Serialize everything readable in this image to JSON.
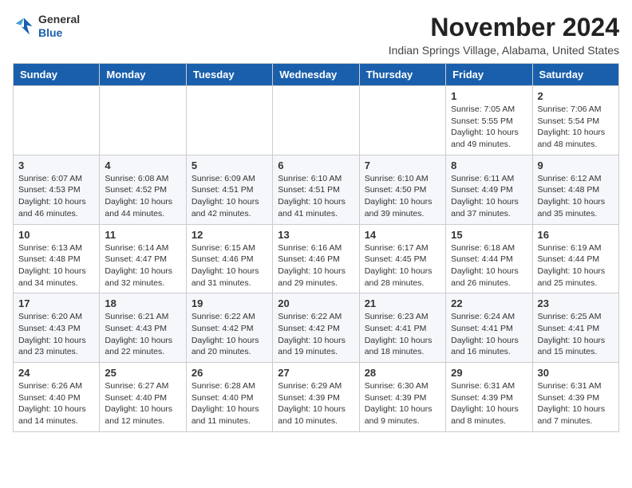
{
  "logo": {
    "line1": "General",
    "line2": "Blue"
  },
  "title": "November 2024",
  "location": "Indian Springs Village, Alabama, United States",
  "days_of_week": [
    "Sunday",
    "Monday",
    "Tuesday",
    "Wednesday",
    "Thursday",
    "Friday",
    "Saturday"
  ],
  "weeks": [
    [
      {
        "day": "",
        "info": ""
      },
      {
        "day": "",
        "info": ""
      },
      {
        "day": "",
        "info": ""
      },
      {
        "day": "",
        "info": ""
      },
      {
        "day": "",
        "info": ""
      },
      {
        "day": "1",
        "info": "Sunrise: 7:05 AM\nSunset: 5:55 PM\nDaylight: 10 hours and 49 minutes."
      },
      {
        "day": "2",
        "info": "Sunrise: 7:06 AM\nSunset: 5:54 PM\nDaylight: 10 hours and 48 minutes."
      }
    ],
    [
      {
        "day": "3",
        "info": "Sunrise: 6:07 AM\nSunset: 4:53 PM\nDaylight: 10 hours and 46 minutes."
      },
      {
        "day": "4",
        "info": "Sunrise: 6:08 AM\nSunset: 4:52 PM\nDaylight: 10 hours and 44 minutes."
      },
      {
        "day": "5",
        "info": "Sunrise: 6:09 AM\nSunset: 4:51 PM\nDaylight: 10 hours and 42 minutes."
      },
      {
        "day": "6",
        "info": "Sunrise: 6:10 AM\nSunset: 4:51 PM\nDaylight: 10 hours and 41 minutes."
      },
      {
        "day": "7",
        "info": "Sunrise: 6:10 AM\nSunset: 4:50 PM\nDaylight: 10 hours and 39 minutes."
      },
      {
        "day": "8",
        "info": "Sunrise: 6:11 AM\nSunset: 4:49 PM\nDaylight: 10 hours and 37 minutes."
      },
      {
        "day": "9",
        "info": "Sunrise: 6:12 AM\nSunset: 4:48 PM\nDaylight: 10 hours and 35 minutes."
      }
    ],
    [
      {
        "day": "10",
        "info": "Sunrise: 6:13 AM\nSunset: 4:48 PM\nDaylight: 10 hours and 34 minutes."
      },
      {
        "day": "11",
        "info": "Sunrise: 6:14 AM\nSunset: 4:47 PM\nDaylight: 10 hours and 32 minutes."
      },
      {
        "day": "12",
        "info": "Sunrise: 6:15 AM\nSunset: 4:46 PM\nDaylight: 10 hours and 31 minutes."
      },
      {
        "day": "13",
        "info": "Sunrise: 6:16 AM\nSunset: 4:46 PM\nDaylight: 10 hours and 29 minutes."
      },
      {
        "day": "14",
        "info": "Sunrise: 6:17 AM\nSunset: 4:45 PM\nDaylight: 10 hours and 28 minutes."
      },
      {
        "day": "15",
        "info": "Sunrise: 6:18 AM\nSunset: 4:44 PM\nDaylight: 10 hours and 26 minutes."
      },
      {
        "day": "16",
        "info": "Sunrise: 6:19 AM\nSunset: 4:44 PM\nDaylight: 10 hours and 25 minutes."
      }
    ],
    [
      {
        "day": "17",
        "info": "Sunrise: 6:20 AM\nSunset: 4:43 PM\nDaylight: 10 hours and 23 minutes."
      },
      {
        "day": "18",
        "info": "Sunrise: 6:21 AM\nSunset: 4:43 PM\nDaylight: 10 hours and 22 minutes."
      },
      {
        "day": "19",
        "info": "Sunrise: 6:22 AM\nSunset: 4:42 PM\nDaylight: 10 hours and 20 minutes."
      },
      {
        "day": "20",
        "info": "Sunrise: 6:22 AM\nSunset: 4:42 PM\nDaylight: 10 hours and 19 minutes."
      },
      {
        "day": "21",
        "info": "Sunrise: 6:23 AM\nSunset: 4:41 PM\nDaylight: 10 hours and 18 minutes."
      },
      {
        "day": "22",
        "info": "Sunrise: 6:24 AM\nSunset: 4:41 PM\nDaylight: 10 hours and 16 minutes."
      },
      {
        "day": "23",
        "info": "Sunrise: 6:25 AM\nSunset: 4:41 PM\nDaylight: 10 hours and 15 minutes."
      }
    ],
    [
      {
        "day": "24",
        "info": "Sunrise: 6:26 AM\nSunset: 4:40 PM\nDaylight: 10 hours and 14 minutes."
      },
      {
        "day": "25",
        "info": "Sunrise: 6:27 AM\nSunset: 4:40 PM\nDaylight: 10 hours and 12 minutes."
      },
      {
        "day": "26",
        "info": "Sunrise: 6:28 AM\nSunset: 4:40 PM\nDaylight: 10 hours and 11 minutes."
      },
      {
        "day": "27",
        "info": "Sunrise: 6:29 AM\nSunset: 4:39 PM\nDaylight: 10 hours and 10 minutes."
      },
      {
        "day": "28",
        "info": "Sunrise: 6:30 AM\nSunset: 4:39 PM\nDaylight: 10 hours and 9 minutes."
      },
      {
        "day": "29",
        "info": "Sunrise: 6:31 AM\nSunset: 4:39 PM\nDaylight: 10 hours and 8 minutes."
      },
      {
        "day": "30",
        "info": "Sunrise: 6:31 AM\nSunset: 4:39 PM\nDaylight: 10 hours and 7 minutes."
      }
    ]
  ]
}
